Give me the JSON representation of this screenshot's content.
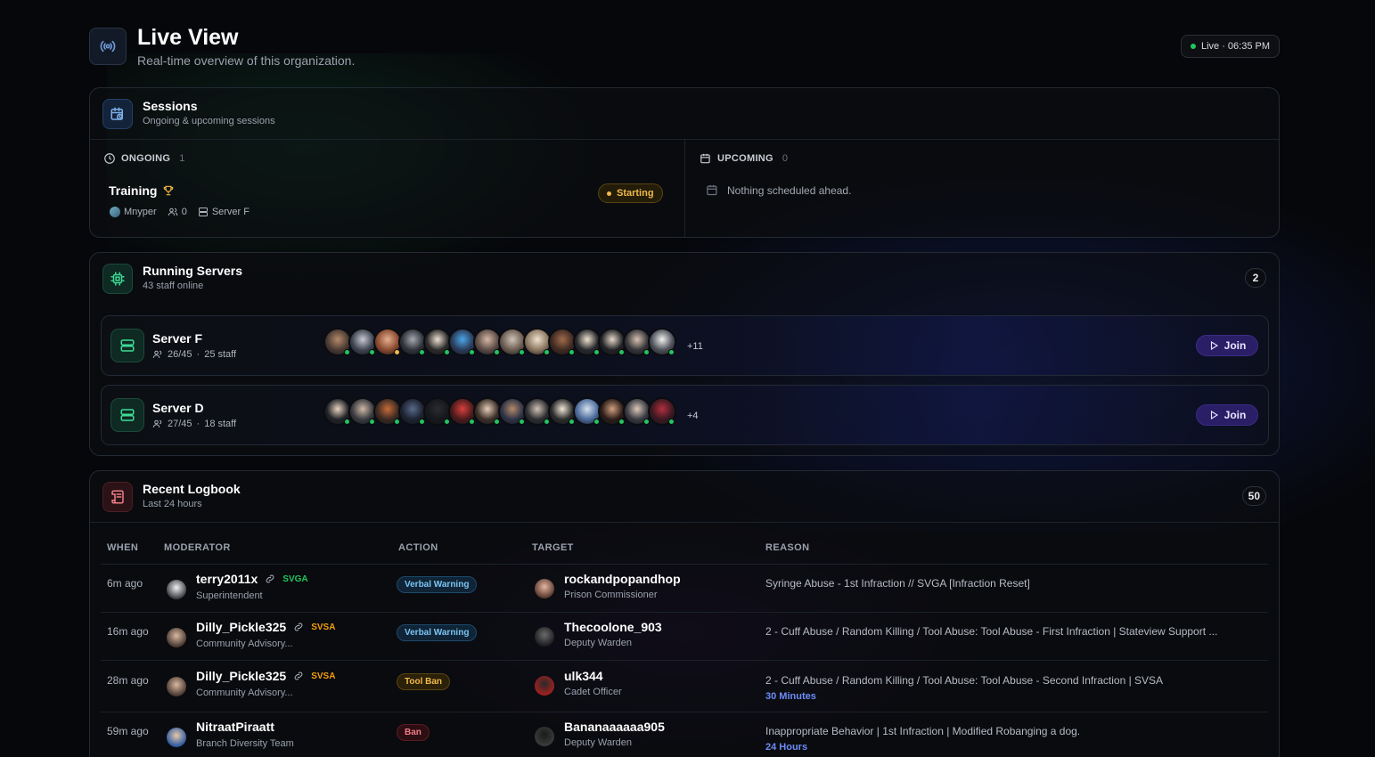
{
  "header": {
    "title": "Live View",
    "subtitle": "Real-time overview of this organization.",
    "live_label": "Live · 06:35 PM",
    "icon": "broadcast-icon"
  },
  "sessions": {
    "title": "Sessions",
    "subtitle": "Ongoing & upcoming sessions",
    "ongoing_label": "ONGOING",
    "ongoing_count": "1",
    "upcoming_label": "UPCOMING",
    "upcoming_count": "0",
    "session": {
      "name": "Training",
      "host": "Mnyper",
      "participants": "0",
      "server": "Server F",
      "status": "Starting"
    },
    "upcoming_empty": "Nothing scheduled ahead."
  },
  "servers": {
    "title": "Running Servers",
    "subtitle": "43 staff online",
    "count": "2",
    "items": [
      {
        "name": "Server F",
        "players": "26/45",
        "staff": "25 staff",
        "more": "+11",
        "join_label": "Join"
      },
      {
        "name": "Server D",
        "players": "27/45",
        "staff": "18 staff",
        "more": "+4",
        "join_label": "Join"
      }
    ]
  },
  "logbook": {
    "title": "Recent Logbook",
    "subtitle": "Last 24 hours",
    "count": "50",
    "columns": [
      "WHEN",
      "MODERATOR",
      "ACTION",
      "TARGET",
      "REASON"
    ],
    "rows": [
      {
        "when": "6m ago",
        "moderator": "terry2011x",
        "tag": "SVGA",
        "tag_color": "#22c55e",
        "mod_role": "Superintendent",
        "action": "Verbal Warning",
        "action_kind": "verbal",
        "target": "rockandpopandhop",
        "target_role": "Prison Commissioner",
        "reason": "Syringe Abuse - 1st Infraction // SVGA [Infraction Reset]",
        "duration": ""
      },
      {
        "when": "16m ago",
        "moderator": "Dilly_Pickle325",
        "tag": "SVSA",
        "tag_color": "#f59e0b",
        "mod_role": "Community Advisory...",
        "action": "Verbal Warning",
        "action_kind": "verbal",
        "target": "Thecoolone_903",
        "target_role": "Deputy Warden",
        "reason": "2 - Cuff Abuse / Random Killing / Tool Abuse: Tool Abuse - First Infraction | Stateview Support ...",
        "duration": ""
      },
      {
        "when": "28m ago",
        "moderator": "Dilly_Pickle325",
        "tag": "SVSA",
        "tag_color": "#f59e0b",
        "mod_role": "Community Advisory...",
        "action": "Tool Ban",
        "action_kind": "tool",
        "target": "ulk344",
        "target_role": "Cadet Officer",
        "reason": "2 - Cuff Abuse / Random Killing / Tool Abuse: Tool Abuse - Second Infraction | SVSA",
        "duration": "30 Minutes"
      },
      {
        "when": "59m ago",
        "moderator": "NitraatPiraatt",
        "tag": "",
        "tag_color": "",
        "mod_role": "Branch Diversity Team",
        "action": "Ban",
        "action_kind": "ban",
        "target": "Bananaaaaaa905",
        "target_role": "Deputy Warden",
        "reason": "Inappropriate Behavior | 1st Infraction | Modified Robanging a dog.",
        "duration": "24 Hours"
      }
    ]
  },
  "colors": {
    "accent_green": "#22c55e",
    "accent_amber": "#f1b94a",
    "join_purple": "#2a1e66",
    "duration_blue": "#6d8cf7"
  }
}
